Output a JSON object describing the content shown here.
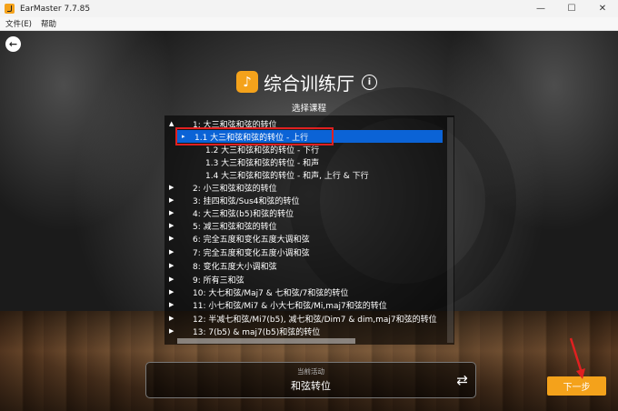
{
  "window": {
    "title": "EarMaster 7.7.85",
    "minimize": "—",
    "maximize": "☐",
    "close": "✕"
  },
  "menu": {
    "file": "文件(E)",
    "help": "帮助"
  },
  "header": {
    "title": "综合训练厅",
    "music_icon": "♪",
    "info_icon": "i"
  },
  "back_icon": "←",
  "list": {
    "subtitle": "选择课程",
    "items": [
      {
        "arrow": "▲",
        "label": "1: 大三和弦和弦的转位"
      },
      {
        "arrow": "▸",
        "label": "1.1 大三和弦和弦的转位 - 上行",
        "selected": true
      },
      {
        "arrow": "",
        "label": "1.2 大三和弦和弦的转位 - 下行"
      },
      {
        "arrow": "",
        "label": "1.3 大三和弦和弦的转位 - 和声"
      },
      {
        "arrow": "",
        "label": "1.4 大三和弦和弦的转位 - 和声, 上行 & 下行"
      },
      {
        "arrow": "▶",
        "label": "2: 小三和弦和弦的转位"
      },
      {
        "arrow": "▶",
        "label": "3: 挂四和弦/Sus4和弦的转位"
      },
      {
        "arrow": "▶",
        "label": "4: 大三和弦(b5)和弦的转位"
      },
      {
        "arrow": "▶",
        "label": "5: 减三和弦和弦的转位"
      },
      {
        "arrow": "▶",
        "label": "6: 完全五度和变化五度大调和弦"
      },
      {
        "arrow": "▶",
        "label": "7: 完全五度和变化五度小调和弦"
      },
      {
        "arrow": "▶",
        "label": "8: 变化五度大小调和弦"
      },
      {
        "arrow": "▶",
        "label": "9: 所有三和弦"
      },
      {
        "arrow": "▶",
        "label": "10: 大七和弦/Maj7 & 七和弦/7和弦的转位"
      },
      {
        "arrow": "▶",
        "label": "11: 小七和弦/Mi7 & 小大七和弦/Mi,maj7和弦的转位"
      },
      {
        "arrow": "▶",
        "label": "12: 半减七和弦/Mi7(b5), 减七和弦/Dim7 & dim,maj7和弦的转位"
      },
      {
        "arrow": "▶",
        "label": "13: 7(b5) & maj7(b5)和弦的转位"
      }
    ]
  },
  "activity": {
    "label": "当前活动",
    "value": "和弦转位",
    "swap_icon": "⇄"
  },
  "next_button": "下一步",
  "colors": {
    "accent": "#f4a21b",
    "selection": "#0b63d6",
    "annotation": "#e02020"
  }
}
